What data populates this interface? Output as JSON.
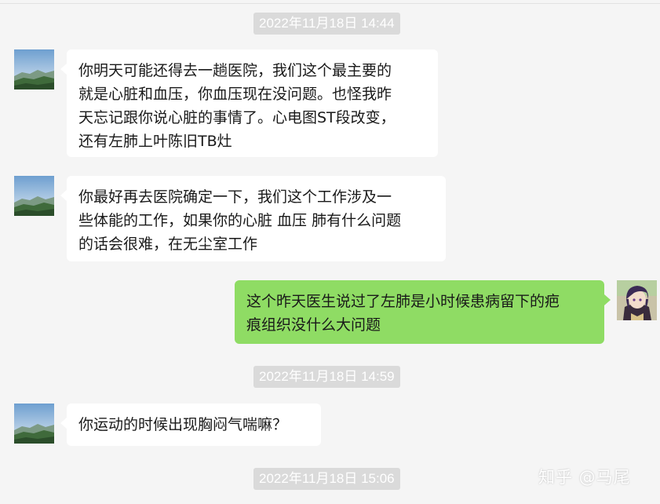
{
  "chat": {
    "timestamps": [
      "2022年11月18日 14:44",
      "2022年11月18日 14:59",
      "2022年11月18日 15:06"
    ],
    "messages": [
      {
        "sender": "contact",
        "text": "你明天可能还得去一趟医院，我们这个最主要的\n就是心脏和血压，你血压现在没问题。也怪我昨\n天忘记跟你说心脏的事情了。心电图ST段改变，\n还有左肺上叶陈旧TB灶"
      },
      {
        "sender": "contact",
        "text": "你最好再去医院确定一下，我们这个工作涉及一\n些体能的工作，如果你的心脏 血压 肺有什么问题\n的话会很难，在无尘室工作"
      },
      {
        "sender": "self",
        "text": "这个昨天医生说过了左肺是小时候患病留下的疤\n痕组织没什么大问题"
      },
      {
        "sender": "contact",
        "text": "你运动的时候出现胸闷气喘嘛？"
      }
    ]
  },
  "avatars": {
    "contact": "landscape-avatar",
    "self": "anime-character-avatar"
  },
  "watermark": "知乎 @马尾",
  "colors": {
    "background": "#f5f5f5",
    "incoming_bubble": "#ffffff",
    "outgoing_bubble": "#8fdc64",
    "timestamp_bg": "#dadada"
  }
}
